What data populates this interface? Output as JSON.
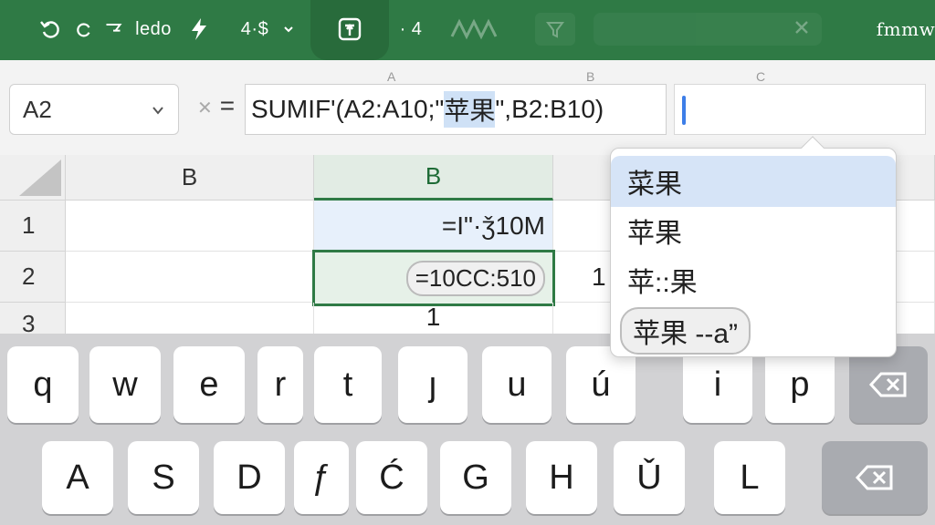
{
  "ribbon": {
    "format_label": "4·$",
    "dot_label": "· 4",
    "right_label": "fmmw",
    "undo_text": "ledo"
  },
  "column_markers": [
    "A",
    "B",
    "C"
  ],
  "name_box": {
    "value": "A2"
  },
  "formula_bar": {
    "fx_symbol": "=",
    "before": "SUMIF'(A2:A10;\"",
    "highlight": "苹果",
    "after": "\",B2:B10)"
  },
  "grid": {
    "columns": [
      "B",
      "B"
    ],
    "rows": [
      "1",
      "2",
      "3"
    ],
    "cells": {
      "r1_b2": "=I\"·ǯ10M",
      "r2_b2": "=10CC:510",
      "r2_c": "1",
      "r3_b2": "1"
    }
  },
  "autocomplete": {
    "items": [
      "菜果",
      "苹果",
      "苹::果",
      "苹果 --a”"
    ]
  },
  "keyboard": {
    "row1": [
      "q",
      "w",
      "e",
      "r",
      "t",
      "ȷ",
      "u",
      "ú",
      "i",
      "p"
    ],
    "row2": [
      "A",
      "S",
      "D",
      "ƒ",
      "Ć",
      "G",
      "H",
      "Ǔ",
      "L"
    ]
  },
  "colors": {
    "ribbon": "#2f7a45",
    "selection_fill": "#e6f1e8",
    "highlight_blue": "#cfe1f6",
    "caret": "#3d7ee8"
  },
  "icons": [
    "undo-icon",
    "redo-icon",
    "flash-fill-icon",
    "insert-function-icon",
    "sort-icon",
    "backspace-icon",
    "chevron-down-icon"
  ]
}
